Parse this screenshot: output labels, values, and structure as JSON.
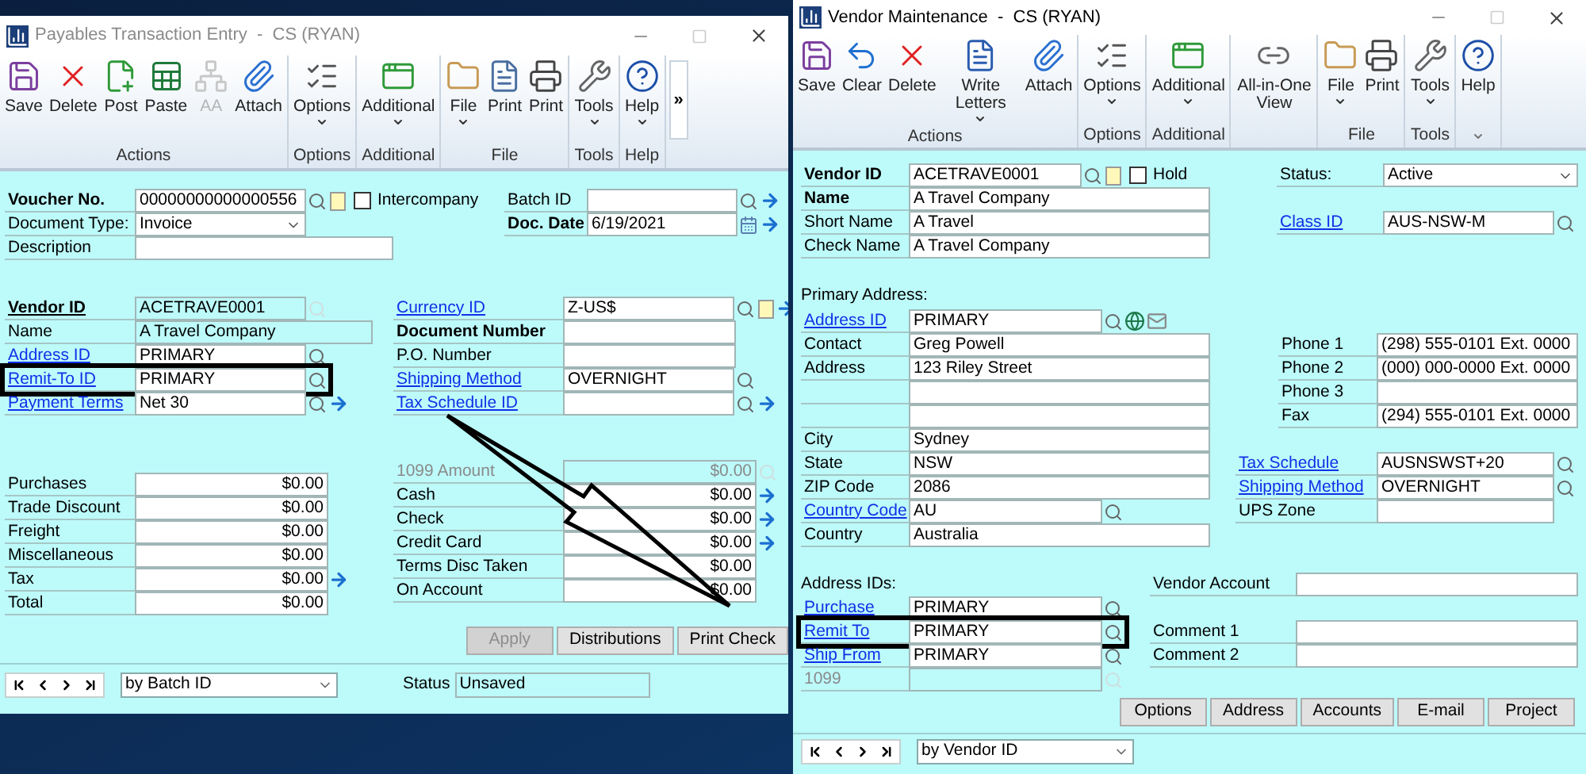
{
  "payables": {
    "title": "Payables Transaction Entry  -  CS (RYAN)",
    "active": false,
    "arrow_annotation": true,
    "ribbon": {
      "overflow": "»",
      "groups": [
        {
          "label": "Actions",
          "buttons": [
            {
              "label": "Save",
              "disabled": false,
              "dropdown": false
            },
            {
              "label": "Delete",
              "disabled": false,
              "dropdown": false
            },
            {
              "label": "Post",
              "disabled": false,
              "dropdown": false
            },
            {
              "label": "Paste",
              "disabled": false,
              "dropdown": false
            },
            {
              "label": "AA",
              "disabled": true,
              "dropdown": false
            },
            {
              "label": "Attach",
              "disabled": false,
              "dropdown": false
            }
          ]
        },
        {
          "label": "Options",
          "buttons": [
            {
              "label": "Options",
              "disabled": false,
              "dropdown": true
            }
          ]
        },
        {
          "label": "Additional",
          "buttons": [
            {
              "label": "Additional",
              "disabled": false,
              "dropdown": true
            }
          ]
        },
        {
          "label": "File",
          "buttons": [
            {
              "label": "File",
              "disabled": false,
              "dropdown": true
            },
            {
              "label": "Print",
              "disabled": false,
              "dropdown": false
            },
            {
              "label": "Print",
              "disabled": false,
              "dropdown": false
            }
          ]
        },
        {
          "label": "Tools",
          "buttons": [
            {
              "label": "Tools",
              "disabled": false,
              "dropdown": true
            }
          ]
        },
        {
          "label": "Help",
          "buttons": [
            {
              "label": "Help",
              "disabled": false,
              "dropdown": true
            }
          ]
        }
      ]
    },
    "header_left": [
      {
        "label": "Voucher No.",
        "kind": "bold",
        "value": "00000000000000556",
        "buttons": [
          {
            "kind": "lookup"
          },
          {
            "kind": "note"
          }
        ],
        "checkbox": {
          "label": "Intercompany",
          "checked": false
        }
      },
      {
        "label": "Document Type:",
        "kind": "plain",
        "value": "Invoice",
        "dropdown": true
      },
      {
        "label": "Description",
        "kind": "plain"
      }
    ],
    "header_right": [
      {
        "label": "Batch ID",
        "kind": "plain",
        "buttons": [
          {
            "kind": "lookup"
          },
          {
            "kind": "arrow"
          }
        ]
      },
      {
        "label": "Doc. Date",
        "kind": "bold",
        "value": "6/19/2021",
        "buttons": [
          {
            "kind": "calendar"
          },
          {
            "kind": "arrow"
          }
        ]
      }
    ],
    "vendor_left": [
      {
        "label": "Vendor ID",
        "kind": "bold_underline",
        "value": "ACETRAVE0001",
        "readonly": true,
        "buttons": [
          {
            "kind": "lookup_disabled"
          }
        ]
      },
      {
        "label": "Name",
        "kind": "plain",
        "value": "A Travel Company",
        "readonly": true
      },
      {
        "label": "Address ID",
        "kind": "link",
        "value": "PRIMARY",
        "buttons": [
          {
            "kind": "lookup"
          }
        ]
      },
      {
        "label": "Remit-To ID",
        "kind": "link",
        "value": "PRIMARY",
        "buttons": [
          {
            "kind": "lookup"
          }
        ],
        "highlighted": true
      },
      {
        "label": "Payment Terms",
        "kind": "link",
        "value": "Net 30",
        "buttons": [
          {
            "kind": "lookup"
          },
          {
            "kind": "arrow"
          }
        ]
      }
    ],
    "vendor_right": [
      {
        "label": "Currency ID",
        "kind": "link",
        "value": "Z-US$",
        "buttons": [
          {
            "kind": "lookup"
          },
          {
            "kind": "note"
          },
          {
            "kind": "arrow"
          }
        ]
      },
      {
        "label": "Document Number",
        "kind": "bold"
      },
      {
        "label": "P.O. Number",
        "kind": "plain"
      },
      {
        "label": "Shipping Method",
        "kind": "link",
        "value": "OVERNIGHT",
        "buttons": [
          {
            "kind": "lookup"
          }
        ]
      },
      {
        "label": "Tax Schedule ID",
        "kind": "link",
        "buttons": [
          {
            "kind": "lookup"
          },
          {
            "kind": "arrow"
          }
        ]
      }
    ],
    "totals_left": [
      {
        "label": "Purchases",
        "kind": "plain",
        "value": "$0.00"
      },
      {
        "label": "Trade Discount",
        "kind": "plain",
        "value": "$0.00"
      },
      {
        "label": "Freight",
        "kind": "plain",
        "value": "$0.00"
      },
      {
        "label": "Miscellaneous",
        "kind": "plain",
        "value": "$0.00"
      },
      {
        "label": "Tax",
        "kind": "plain",
        "value": "$0.00",
        "buttons": [
          {
            "kind": "arrow"
          }
        ]
      },
      {
        "label": "Total",
        "kind": "plain",
        "value": "$0.00"
      }
    ],
    "totals_right": [
      {
        "label": "1099 Amount",
        "kind": "disabled",
        "value": "$0.00",
        "readonly": true,
        "buttons": [
          {
            "kind": "lookup_disabled"
          }
        ]
      },
      {
        "label": "Cash",
        "kind": "plain",
        "value": "$0.00",
        "buttons": [
          {
            "kind": "arrow"
          }
        ]
      },
      {
        "label": "Check",
        "kind": "plain",
        "value": "$0.00",
        "buttons": [
          {
            "kind": "arrow"
          }
        ]
      },
      {
        "label": "Credit Card",
        "kind": "plain",
        "value": "$0.00",
        "buttons": [
          {
            "kind": "arrow"
          }
        ]
      },
      {
        "label": "Terms Disc Taken",
        "kind": "plain",
        "value": "$0.00"
      },
      {
        "label": "On Account",
        "kind": "plain",
        "value": "$0.00"
      }
    ],
    "buttons": [
      {
        "label": "Apply",
        "disabled": true
      },
      {
        "label": "Distributions",
        "disabled": false
      },
      {
        "label": "Print Check",
        "disabled": false
      }
    ],
    "footer": {
      "sort": "by Batch ID",
      "status_label": "Status",
      "status": "Unsaved"
    }
  },
  "vendor": {
    "title": "Vendor Maintenance  -  CS (RYAN)",
    "active": true,
    "ribbon": {
      "groups": [
        {
          "label": "Actions",
          "buttons": [
            {
              "label": "Save",
              "disabled": false,
              "dropdown": false
            },
            {
              "label": "Clear",
              "disabled": false,
              "dropdown": false
            },
            {
              "label": "Delete",
              "disabled": false,
              "dropdown": false
            },
            {
              "label": "Write Letters",
              "disabled": false,
              "dropdown": true
            },
            {
              "label": "Attach",
              "disabled": false,
              "dropdown": false
            }
          ]
        },
        {
          "label": "Options",
          "buttons": [
            {
              "label": "Options",
              "disabled": false,
              "dropdown": true
            }
          ]
        },
        {
          "label": "Additional",
          "buttons": [
            {
              "label": "Additional",
              "disabled": false,
              "dropdown": true
            }
          ]
        },
        {
          "buttons": [
            {
              "label": "All-in-One View",
              "disabled": false,
              "dropdown": false
            }
          ]
        },
        {
          "label": "File",
          "buttons": [
            {
              "label": "File",
              "disabled": false,
              "dropdown": true
            },
            {
              "label": "Print",
              "disabled": false,
              "dropdown": false
            }
          ]
        },
        {
          "label": "Tools",
          "buttons": [
            {
              "label": "Tools",
              "disabled": false,
              "dropdown": true
            }
          ]
        },
        {
          "dropdown": true,
          "buttons": [
            {
              "label": "Help",
              "disabled": false,
              "dropdown": false
            }
          ]
        }
      ]
    },
    "header_left": [
      {
        "label": "Vendor ID",
        "kind": "bold",
        "value": "ACETRAVE0001",
        "buttons": [
          {
            "kind": "lookup"
          },
          {
            "kind": "note"
          }
        ],
        "checkbox": {
          "label": "Hold",
          "checked": false
        }
      },
      {
        "label": "Name",
        "kind": "bold",
        "value": "A Travel Company"
      },
      {
        "label": "Short Name",
        "kind": "plain",
        "value": "A Travel"
      },
      {
        "label": "Check Name",
        "kind": "plain",
        "value": "A Travel Company"
      }
    ],
    "header_right": [
      {
        "label": "Status:",
        "kind": "plain",
        "value": "Active",
        "dropdown": true
      },
      {
        "label": "Class ID",
        "kind": "link",
        "value": "AUS-NSW-M",
        "buttons": [
          {
            "kind": "lookup"
          }
        ]
      }
    ],
    "primary_address_title": "Primary Address:",
    "address": [
      {
        "label": "Address ID",
        "kind": "link",
        "value": "PRIMARY",
        "buttons": [
          {
            "kind": "lookup"
          },
          {
            "kind": "globe"
          },
          {
            "kind": "mail"
          }
        ]
      },
      {
        "label": "Contact",
        "kind": "plain",
        "value": "Greg Powell"
      },
      {
        "label": "Address",
        "kind": "plain",
        "value": "123 Riley Street"
      },
      {
        "kind": "plain"
      },
      {
        "kind": "plain"
      },
      {
        "label": "City",
        "kind": "plain",
        "value": "Sydney"
      },
      {
        "label": "State",
        "kind": "plain",
        "value": "NSW"
      },
      {
        "label": "ZIP Code",
        "kind": "plain",
        "value": "2086"
      },
      {
        "label": "Country Code",
        "kind": "link",
        "value": "AU",
        "buttons": [
          {
            "kind": "lookup"
          }
        ]
      },
      {
        "label": "Country",
        "kind": "plain",
        "value": "Australia"
      }
    ],
    "phones": [
      {
        "label": "Phone 1",
        "kind": "plain",
        "value": "(298) 555-0101  Ext. 0000"
      },
      {
        "label": "Phone 2",
        "kind": "plain",
        "value": "(000) 000-0000  Ext. 0000"
      },
      {
        "label": "Phone 3",
        "kind": "plain"
      },
      {
        "label": "Fax",
        "kind": "plain",
        "value": "(294) 555-0101  Ext. 0000"
      }
    ],
    "shipping": [
      {
        "label": "Tax Schedule",
        "kind": "link",
        "value": "AUSNSWST+20",
        "buttons": [
          {
            "kind": "lookup"
          }
        ]
      },
      {
        "label": "Shipping Method",
        "kind": "link",
        "value": "OVERNIGHT",
        "buttons": [
          {
            "kind": "lookup"
          }
        ]
      },
      {
        "label": "UPS Zone",
        "kind": "plain"
      }
    ],
    "address_ids_title": "Address IDs:",
    "address_ids": [
      {
        "label": "Purchase",
        "kind": "link",
        "value": "PRIMARY",
        "buttons": [
          {
            "kind": "lookup"
          }
        ]
      },
      {
        "label": "Remit To",
        "kind": "link",
        "value": "PRIMARY",
        "buttons": [
          {
            "kind": "lookup"
          }
        ],
        "highlighted": true
      },
      {
        "label": "Ship From",
        "kind": "link",
        "value": "PRIMARY",
        "buttons": [
          {
            "kind": "lookup"
          }
        ]
      },
      {
        "label": "1099",
        "kind": "disabled",
        "readonly": true,
        "buttons": [
          {
            "kind": "lookup_disabled"
          }
        ]
      }
    ],
    "vendor_account": [
      {
        "label": "Vendor Account",
        "kind": "plain"
      }
    ],
    "comments": [
      {
        "label": "Comment 1",
        "kind": "plain"
      },
      {
        "label": "Comment 2",
        "kind": "plain"
      }
    ],
    "buttons": [
      {
        "label": "Options",
        "disabled": false
      },
      {
        "label": "Address",
        "disabled": false
      },
      {
        "label": "Accounts",
        "disabled": false
      },
      {
        "label": "E-mail",
        "disabled": false
      },
      {
        "label": "Project",
        "disabled": false
      }
    ],
    "footer": {
      "sort": "by Vendor ID"
    }
  }
}
